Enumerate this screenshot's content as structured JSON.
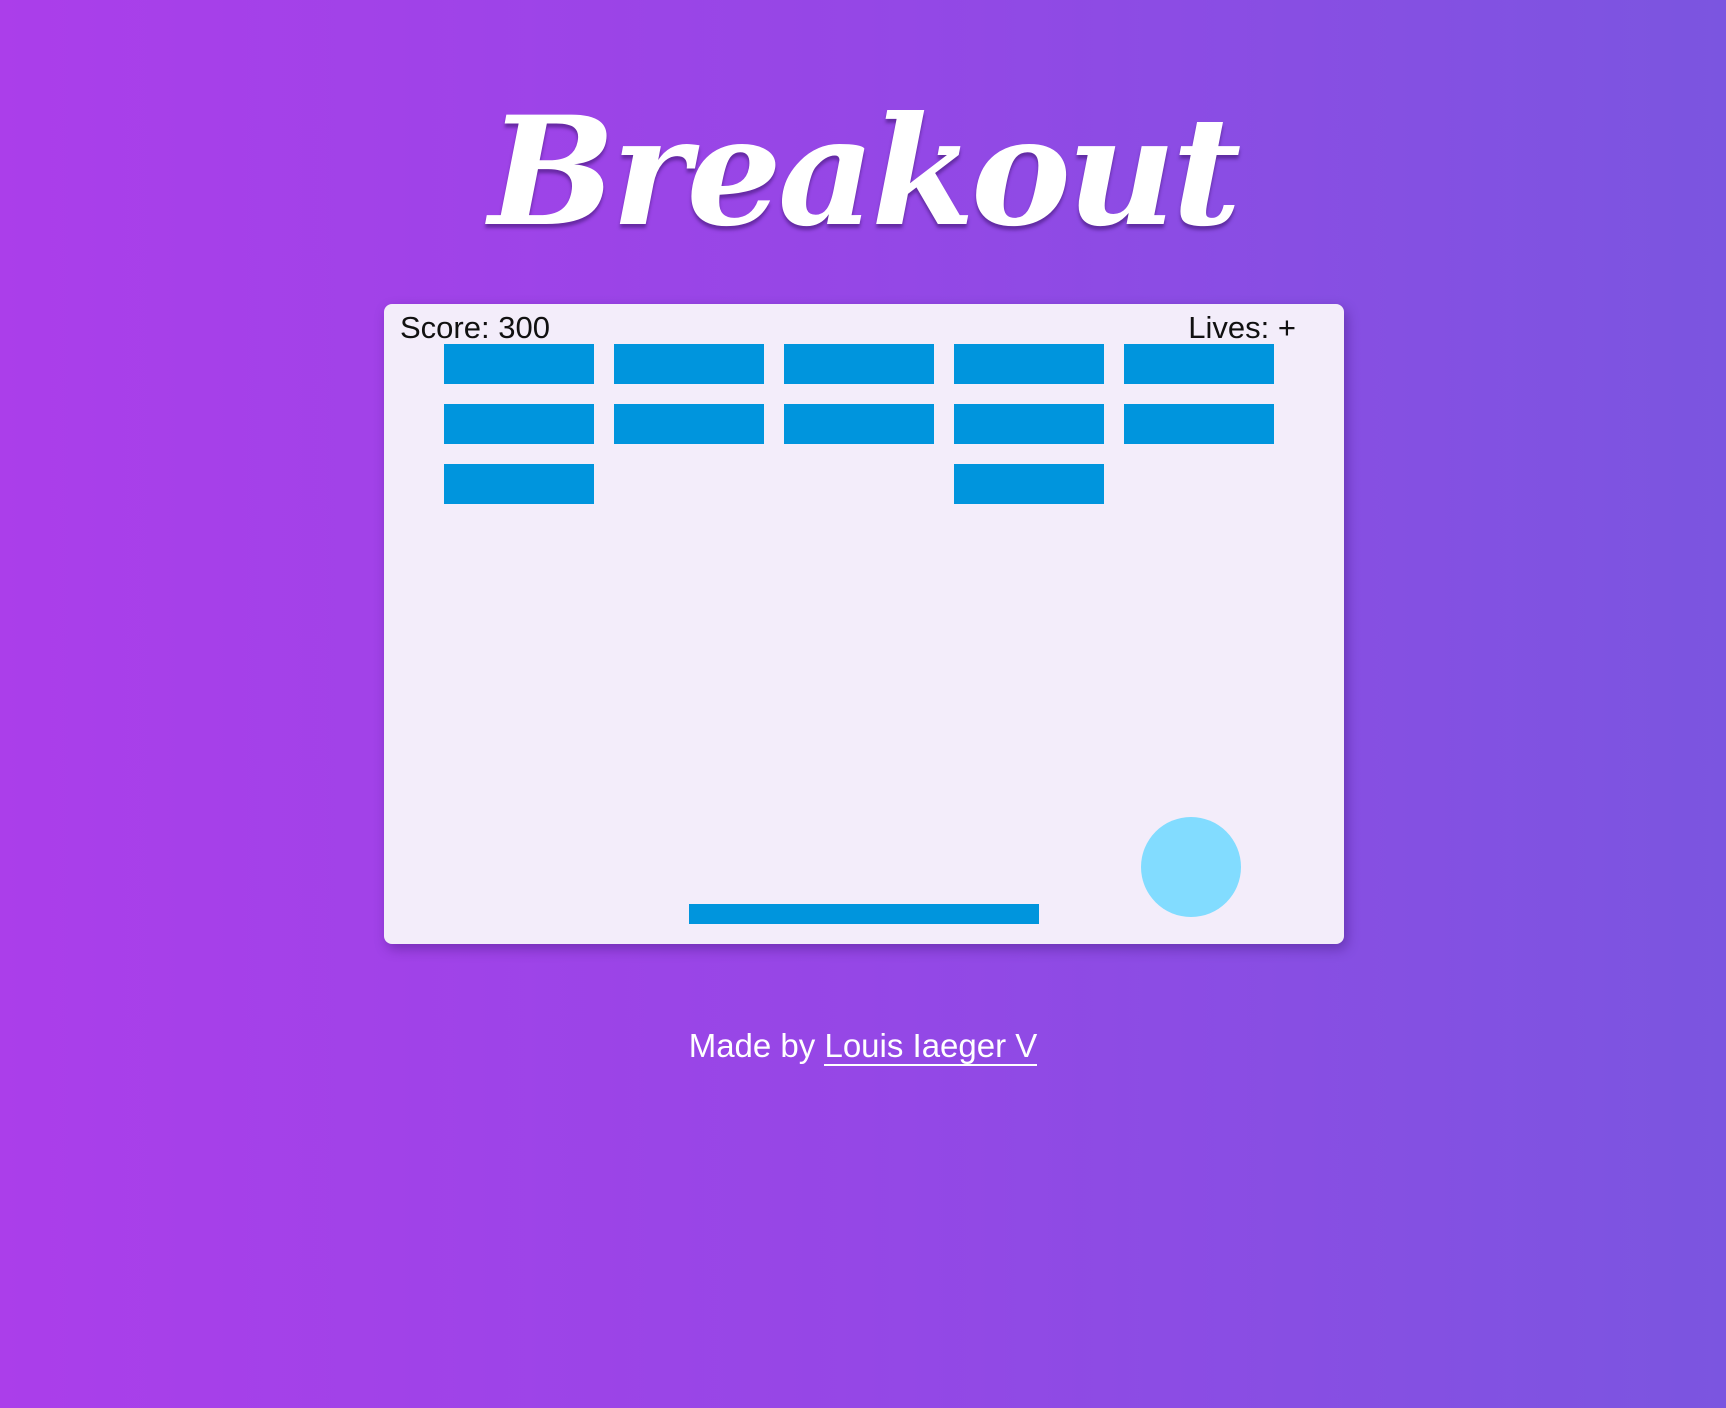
{
  "title": "Breakout",
  "hud": {
    "score_text": "Score: 300",
    "lives_text": "Lives: +"
  },
  "game": {
    "columns": 5,
    "rows": 3,
    "bricks_present": [
      [
        true,
        true,
        true,
        true,
        true
      ],
      [
        true,
        true,
        true,
        true,
        true
      ],
      [
        true,
        false,
        false,
        true,
        false
      ]
    ],
    "colors": {
      "brick": "#0095dd",
      "paddle": "#0095dd",
      "ball": "#82dcff",
      "board": "#f3edfa"
    }
  },
  "footer": {
    "prefix": "Made by ",
    "author": "Louis Iaeger V"
  },
  "colors": {
    "background_start": "#ab3eea",
    "background_end": "#7b55e0",
    "text": "#ffffff"
  }
}
